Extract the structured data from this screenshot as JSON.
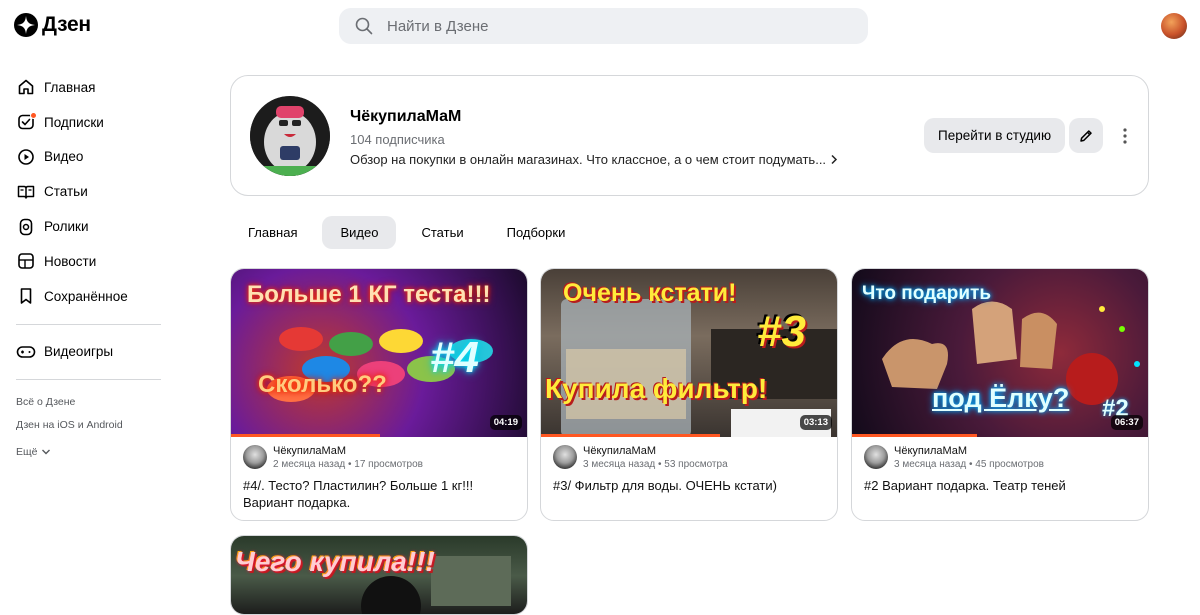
{
  "header": {
    "logo_text": "Дзен",
    "search_placeholder": "Найти в Дзене"
  },
  "sidebar": {
    "items": [
      {
        "label": "Главная",
        "icon": "home-icon"
      },
      {
        "label": "Подписки",
        "icon": "subscriptions-icon"
      },
      {
        "label": "Видео",
        "icon": "video-icon"
      },
      {
        "label": "Статьи",
        "icon": "articles-icon"
      },
      {
        "label": "Ролики",
        "icon": "shorts-icon"
      },
      {
        "label": "Новости",
        "icon": "news-icon"
      },
      {
        "label": "Сохранённое",
        "icon": "bookmark-icon"
      }
    ],
    "games": {
      "label": "Видеоигры",
      "icon": "gamepad-icon"
    },
    "links": [
      "Всё о Дзене",
      "Дзен на iOS и Android",
      "Ещё"
    ]
  },
  "channel": {
    "name": "ЧёкупилаМаМ",
    "subscribers": "104 подписчика",
    "description": "Обзор на покупки в онлайн магазинах. Что классное, а о чем стоит подумать...",
    "studio_button": "Перейти в студию"
  },
  "tabs": [
    {
      "label": "Главная",
      "active": false
    },
    {
      "label": "Видео",
      "active": true
    },
    {
      "label": "Статьи",
      "active": false
    },
    {
      "label": "Подборки",
      "active": false
    }
  ],
  "videos": [
    {
      "thumb_lines": [
        "Больше 1 КГ теста!!!",
        "Сколько??",
        "#4"
      ],
      "duration": "04:19",
      "progress": 0.5,
      "author": "ЧёкупилаМаМ",
      "stats": "2 месяца назад • 17 просмотров",
      "title": "#4/. Тесто? Пластилин? Больше 1 кг!!! Вариант подарка."
    },
    {
      "thumb_lines": [
        "Очень кстати!",
        "#3",
        "Купила фильтр!"
      ],
      "duration": "03:13",
      "progress": 0.6,
      "author": "ЧёкупилаМаМ",
      "stats": "3 месяца назад • 53 просмотра",
      "title": "#3/ Фильтр для воды. ОЧЕНЬ кстати)"
    },
    {
      "thumb_lines": [
        "Что подарить",
        "под Ёлку?",
        "#2"
      ],
      "duration": "06:37",
      "progress": 0.42,
      "author": "ЧёкупилаМаМ",
      "stats": "3 месяца назад • 45 просмотров",
      "title": "#2 Вариант подарка. Театр теней"
    },
    {
      "thumb_lines": [
        "Чего купила!!!"
      ]
    }
  ],
  "colors": {
    "accent": "#ff5722",
    "chip_bg": "#e8e9ec",
    "border": "#d5d7da"
  }
}
